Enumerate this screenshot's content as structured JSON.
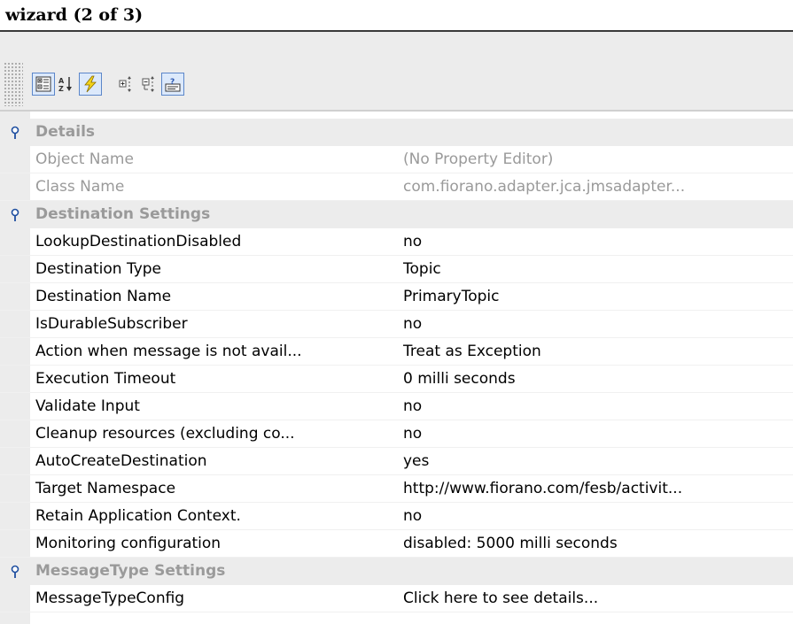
{
  "window": {
    "title": "wizard (2 of 3)"
  },
  "toolbar": {
    "buttons": [
      {
        "name": "categorized-view-icon",
        "active": true
      },
      {
        "name": "sort-alphabetical-icon",
        "active": false
      },
      {
        "name": "lightning-icon",
        "active": true
      },
      {
        "name": "expand-all-icon",
        "active": false
      },
      {
        "name": "collapse-all-icon",
        "active": false
      },
      {
        "name": "show-description-icon",
        "active": true
      }
    ]
  },
  "groups": {
    "details": {
      "title": "Details",
      "props": [
        {
          "name": "Object Name",
          "value": "(No Property Editor)"
        },
        {
          "name": "Class Name",
          "value": "com.fiorano.adapter.jca.jmsadapter..."
        }
      ]
    },
    "destination": {
      "title": "Destination Settings",
      "props": [
        {
          "name": "LookupDestinationDisabled",
          "value": "no"
        },
        {
          "name": "Destination Type",
          "value": "Topic"
        },
        {
          "name": "Destination Name",
          "value": "PrimaryTopic"
        },
        {
          "name": "IsDurableSubscriber",
          "value": "no"
        },
        {
          "name": "Action when message is not avail...",
          "value": "Treat as Exception"
        },
        {
          "name": "Execution Timeout",
          "value": "0 milli seconds"
        },
        {
          "name": "Validate Input",
          "value": "no"
        },
        {
          "name": "Cleanup resources (excluding co...",
          "value": "no"
        },
        {
          "name": "AutoCreateDestination",
          "value": "yes"
        },
        {
          "name": "Target Namespace",
          "value": "http://www.fiorano.com/fesb/activit..."
        },
        {
          "name": "Retain Application Context.",
          "value": "no"
        },
        {
          "name": "Monitoring configuration",
          "value": "disabled: 5000 milli seconds"
        }
      ]
    },
    "messagetype": {
      "title": "MessageType Settings",
      "props": [
        {
          "name": "MessageTypeConfig",
          "value": "Click here to see details..."
        }
      ]
    }
  },
  "colors": {
    "toolbar_bg": "#ececec",
    "disabled_text": "#9a9a9a",
    "active_button_border": "#5b86c9"
  }
}
